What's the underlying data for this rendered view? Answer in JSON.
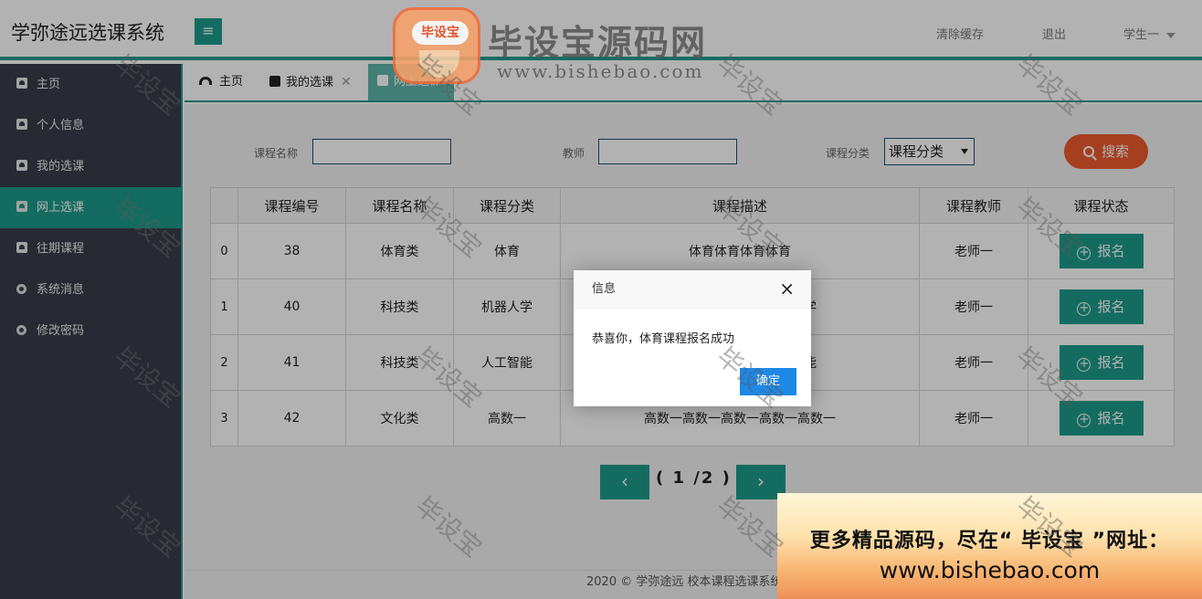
{
  "header": {
    "title": "学弥途远选课系统",
    "menu_icon": "≡",
    "links": [
      "清除缓存",
      "退出"
    ],
    "user": "学生一"
  },
  "sidebar": {
    "items": [
      {
        "label": "主页",
        "icon": "user-card-icon"
      },
      {
        "label": "个人信息",
        "icon": "user-card-icon"
      },
      {
        "label": "我的选课",
        "icon": "user-card-icon"
      },
      {
        "label": "网上选课",
        "icon": "user-card-icon",
        "active": true
      },
      {
        "label": "往期课程",
        "icon": "user-card-icon"
      },
      {
        "label": "系统消息",
        "icon": "circle-dot-icon"
      },
      {
        "label": "修改密码",
        "icon": "circle-dot-icon"
      }
    ]
  },
  "tabs": [
    {
      "label": "主页",
      "icon": "dashboard-icon"
    },
    {
      "label": "我的选课",
      "icon": "user-card-icon",
      "closable": true
    },
    {
      "label": "网上选课",
      "icon": "user-card-icon",
      "active": true
    }
  ],
  "search": {
    "course_name_label": "课程名称",
    "course_name_value": "",
    "teacher_label": "教师",
    "teacher_value": "",
    "category_label": "课程分类",
    "category_selected": "课程分类",
    "search_button": "搜索"
  },
  "table": {
    "headers": [
      "",
      "课程编号",
      "课程名称",
      "课程分类",
      "课程描述",
      "课程教师",
      "课程状态"
    ],
    "rows": [
      {
        "index": "0",
        "id": "38",
        "name": "体育类",
        "category": "体育",
        "desc": "体育体育体育体育",
        "teacher": "老师一",
        "action": "报名"
      },
      {
        "index": "1",
        "id": "40",
        "name": "科技类",
        "category": "机器人学",
        "desc": "机器人学机器人学机器人学",
        "teacher": "老师一",
        "action": "报名"
      },
      {
        "index": "2",
        "id": "41",
        "name": "科技类",
        "category": "人工智能",
        "desc": "人工智能人工智能人工智能",
        "teacher": "老师一",
        "action": "报名"
      },
      {
        "index": "3",
        "id": "42",
        "name": "文化类",
        "category": "高数一",
        "desc": "高数一高数一高数一高数一高数一",
        "teacher": "老师一",
        "action": "报名"
      }
    ]
  },
  "pager": {
    "prev": "‹",
    "text": "( 1 /2 )",
    "next": "›"
  },
  "footer": {
    "text": "2020 ©  学弥途远  校本课程选课系统"
  },
  "modal": {
    "title": "信息",
    "message": "恭喜你，体育课程报名成功",
    "ok": "确定",
    "close": "×"
  },
  "watermark": {
    "text": "毕设宝",
    "logo_badge": "毕设宝",
    "logo_brand": "毕设宝源码网",
    "logo_url": "www.bishebao.com"
  },
  "promo": {
    "line1": "更多精品源码，尽在“ 毕设宝 ”网址：",
    "line2": "www.bishebao.com"
  },
  "colors": {
    "accent": "#1e9b8a",
    "sidebar_bg": "#393d49",
    "search_btn": "#ee5a2e",
    "ok_btn": "#1e88e5"
  }
}
